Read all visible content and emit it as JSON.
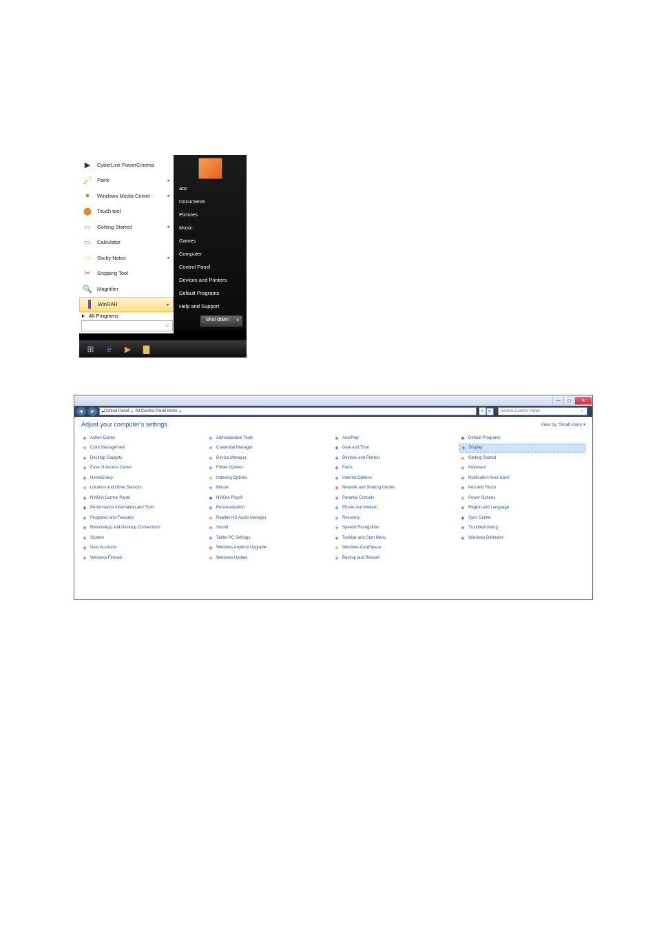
{
  "start_menu": {
    "programs": [
      {
        "label": "CyberLink PowerCinema",
        "icon": "▶",
        "color": "#333",
        "sub": false
      },
      {
        "label": "Paint",
        "icon": "🖌",
        "color": "#e7b84e",
        "sub": true
      },
      {
        "label": "Windows Media Center",
        "icon": "●",
        "color": "#6cb23d",
        "sub": true
      },
      {
        "label": "Touch tool",
        "icon": "⬤",
        "color": "#e68a2e",
        "sub": false
      },
      {
        "label": "Getting Started",
        "icon": "▭",
        "color": "#8ca5cf",
        "sub": true
      },
      {
        "label": "Calculator",
        "icon": "▭",
        "color": "#8ca5cf",
        "sub": false
      },
      {
        "label": "Sticky Notes",
        "icon": "▭",
        "color": "#f3d86a",
        "sub": true
      },
      {
        "label": "Snipping Tool",
        "icon": "✂",
        "color": "#d05858",
        "sub": false
      },
      {
        "label": "Magnifier",
        "icon": "🔍",
        "color": "#5a7fb5",
        "sub": false
      },
      {
        "label": "WinRAR",
        "icon": "▐",
        "color": "#7a4aa0",
        "sub": true,
        "hl": true
      }
    ],
    "all_programs": "All Programs",
    "search_placeholder": "",
    "right": [
      "aoc",
      "Documents",
      "Pictures",
      "Music",
      "Games",
      "Computer",
      "Control Panel",
      "Devices and Printers",
      "Default Programs",
      "Help and Support"
    ],
    "shutdown": "Shut down"
  },
  "control_panel": {
    "breadcrumb": [
      "Control Panel",
      "All Control Panel Items"
    ],
    "search_placeholder": "Search Control Panel",
    "title": "Adjust your computer's settings",
    "view_by_label": "View by:",
    "view_by_value": "Small icons ▾",
    "items": [
      "Action Center",
      "Administrative Tools",
      "AutoPlay",
      "Backup and Restore",
      "Color Management",
      "Credential Manager",
      "Date and Time",
      "Default Programs",
      "Desktop Gadgets",
      "Device Manager",
      "Devices and Printers",
      "Display",
      "Ease of Access Center",
      "Folder Options",
      "Fonts",
      "Getting Started",
      "HomeGroup",
      "Indexing Options",
      "Internet Options",
      "Keyboard",
      "Location and Other Sensors",
      "Mouse",
      "Network and Sharing Center",
      "Notification Area Icons",
      "NVIDIA Control Panel",
      "NVIDIA PhysX",
      "Parental Controls",
      "Pen and Touch",
      "Performance Information and Tools",
      "Personalization",
      "Phone and Modem",
      "Power Options",
      "Programs and Features",
      "Realtek HD Audio Manager",
      "Recovery",
      "Region and Language",
      "RemoteApp and Desktop Connections",
      "Sound",
      "Speech Recognition",
      "Sync Center",
      "System",
      "Tablet PC Settings",
      "Taskbar and Start Menu",
      "Troubleshooting",
      "User Accounts",
      "Windows Anytime Upgrade",
      "Windows CardSpace",
      "Windows Defender",
      "Windows Firewall",
      "Windows Update"
    ],
    "selected": "Display",
    "icon_colors": [
      "#3b82c7",
      "#c98f3a",
      "#4b93d6",
      "#9d63c1",
      "#b0548e",
      "#e08a3a",
      "#418c4f",
      "#4d4d4d",
      "#4587ce",
      "#b84b4b",
      "#3c9e6e",
      "#cf4b4b",
      "#946ac2",
      "#4791d2",
      "#4fa8d6",
      "#d67f3a",
      "#3a8cc4",
      "#caa646",
      "#4f9cd6",
      "#4c4c4c"
    ]
  }
}
